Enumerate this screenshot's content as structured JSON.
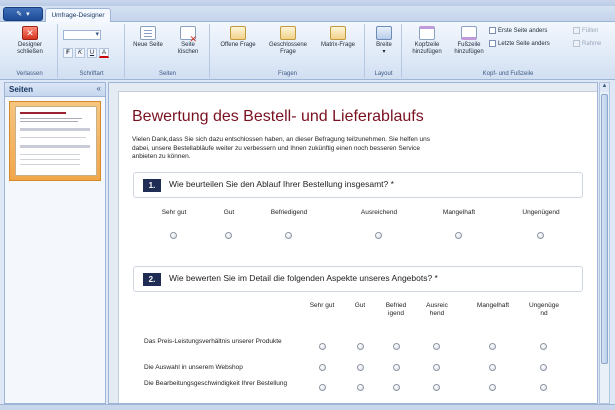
{
  "app": {
    "tab_designer": "Umfrage-Designer"
  },
  "ribbon": {
    "groups": {
      "verlassen": "Verlassen",
      "schriftart": "Schriftart",
      "seiten": "Seiten",
      "fragen": "Fragen",
      "layout": "Layout",
      "kopf_fusszeile": "Kopf- und Fußzeile"
    },
    "buttons": {
      "designer_schliessen": "Designer schließen",
      "neue_seite": "Neue Seite",
      "seite_loeschen": "Seite löschen",
      "offene_frage": "Offene Frage",
      "geschlossene_frage": "Geschlossene Frage",
      "matrix_frage": "Matrix-Frage",
      "breite": "Breite",
      "kopfzeile": "Kopfzeile hinzufügen",
      "fusszeile": "Fußzeile hinzufügen"
    },
    "format": {
      "f": "F",
      "k": "K",
      "u": "U",
      "a": "A"
    },
    "checks": {
      "erste_seite": "Erste Seite anders",
      "letzte_seite": "Letzte Seite anders"
    },
    "disabled": {
      "fuellen": "Füllen",
      "rahmen": "Rahme"
    }
  },
  "sidebar": {
    "title": "Seiten",
    "collapse": "«"
  },
  "survey": {
    "title": "Bewertung des Bestell- und Lieferablaufs",
    "intro": "Vielen Dank,dass Sie sich dazu entschlossen haben, an dieser Befragung teilzunehmen. Sie helfen uns dabei, unsere Bestellabläufe weiter zu verbessern und Ihnen zukünftig einen noch besseren Service anbieten zu können.",
    "q1": {
      "number": "1.",
      "text": "Wie beurteilen Sie den Ablauf Ihrer Bestellung insgesamt? *",
      "scale": [
        "Sehr gut",
        "Gut",
        "Befriedigend",
        "Ausreichend",
        "Mangelhaft",
        "Ungenügend"
      ]
    },
    "q2": {
      "number": "2.",
      "text": "Wie bewerten Sie im Detail die folgenden Aspekte unseres Angebots? *",
      "scale": [
        "Sehr gut",
        "Gut",
        "Befriedigend",
        "Ausreichend",
        "Mangelhaft",
        "Ungenügend"
      ],
      "rows": [
        "Das Preis-Leistungsverhältnis unserer Produkte",
        "Die Auswahl in unserem Webshop",
        "Die Bearbeitungsgeschwindigkeit Ihrer Bestellung"
      ]
    }
  },
  "colors": {
    "title_red": "#7a1020",
    "qnum_navy": "#1f2d55",
    "ribbon_blue": "#dce7f6"
  }
}
